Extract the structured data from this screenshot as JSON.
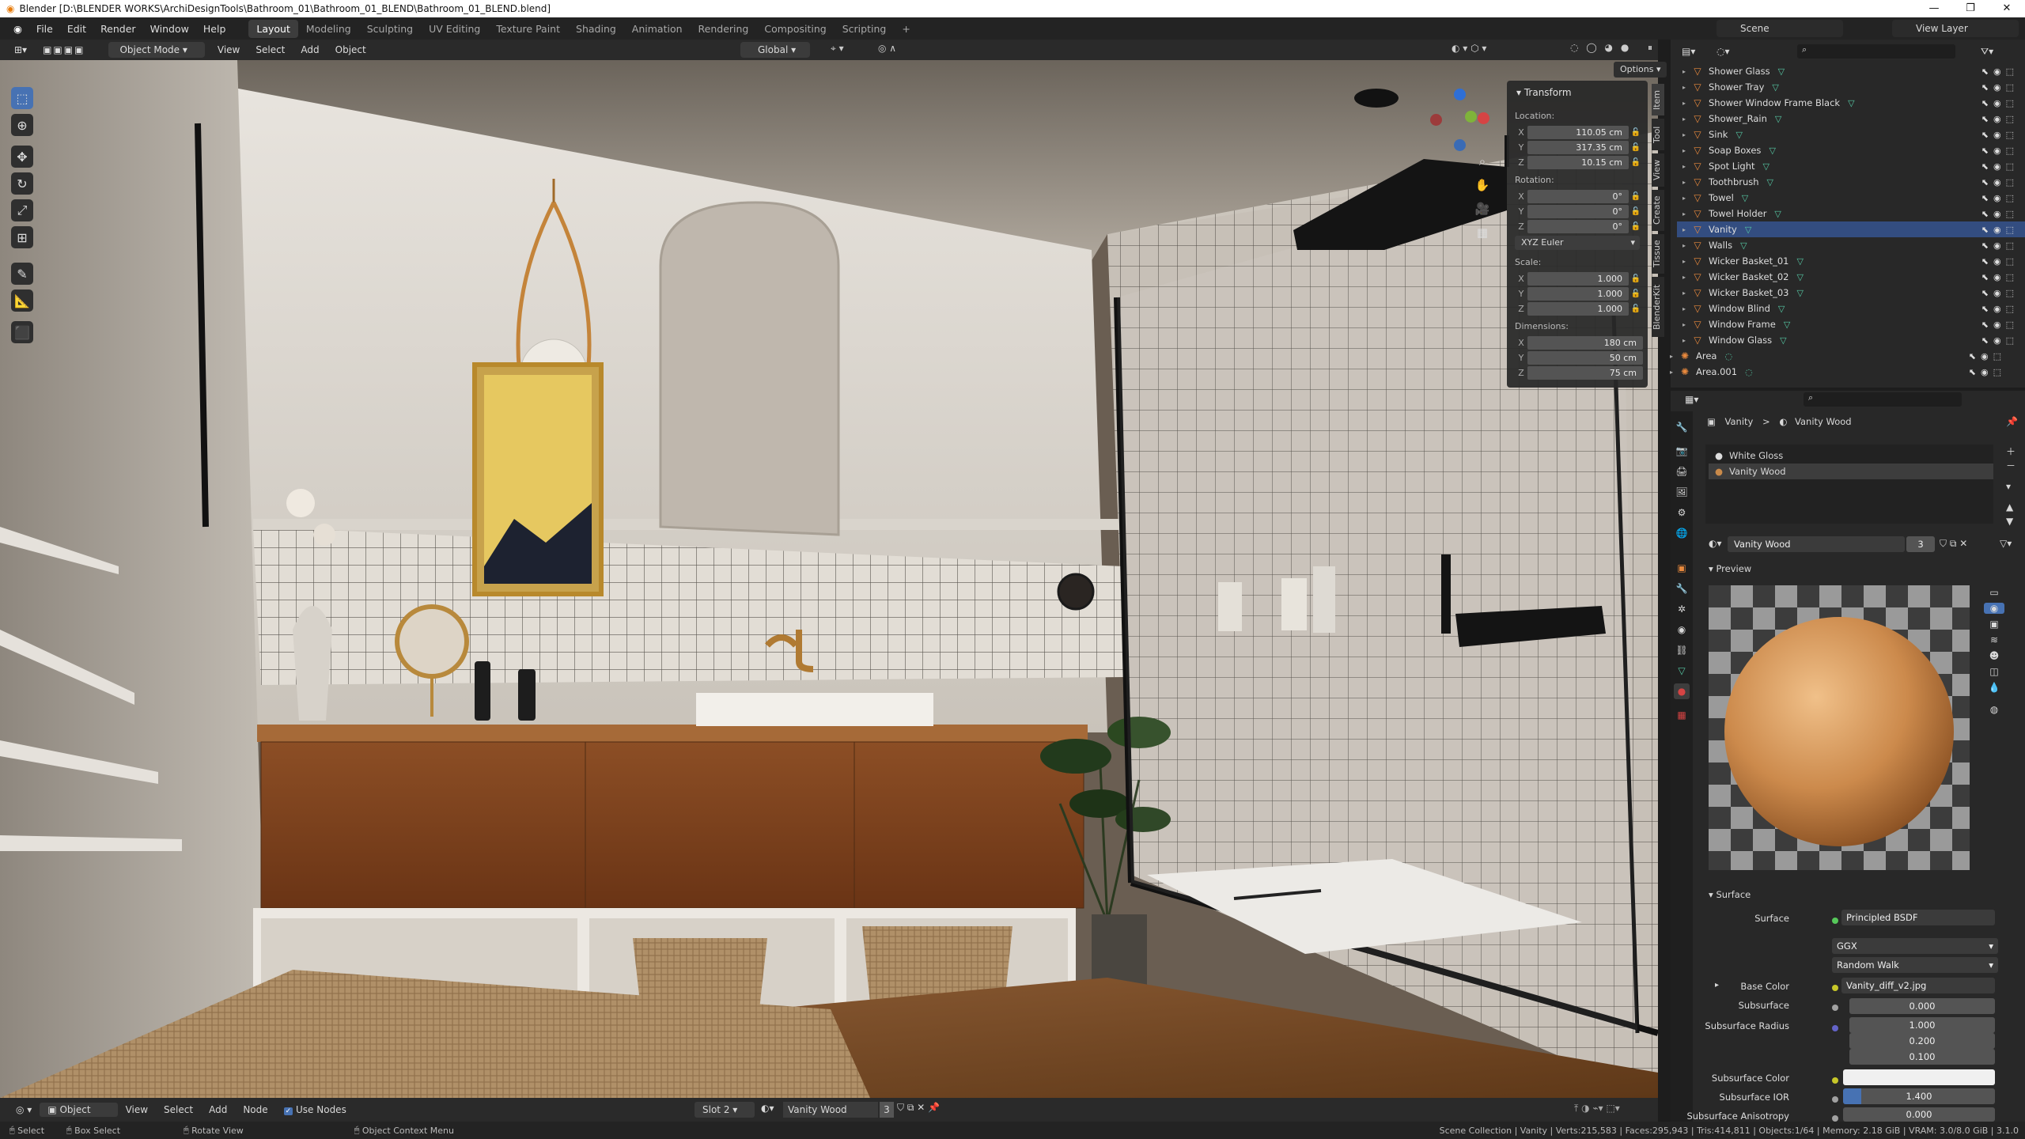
{
  "titlebar": {
    "title": "Blender [D:\\BLENDER WORKS\\ArchiDesignTools\\Bathroom_01\\Bathroom_01_BLEND\\Bathroom_01_BLEND.blend]",
    "min": "—",
    "max": "❐",
    "close": "✕"
  },
  "menu": [
    "File",
    "Edit",
    "Render",
    "Window",
    "Help"
  ],
  "workspaces": [
    "Layout",
    "Modeling",
    "Sculpting",
    "UV Editing",
    "Texture Paint",
    "Shading",
    "Animation",
    "Rendering",
    "Compositing",
    "Scripting"
  ],
  "add_workspace": "+",
  "scene": "Scene",
  "view_layer": "View Layer",
  "viewport_header": {
    "mode": "Object Mode",
    "view": "View",
    "select": "Select",
    "add": "Add",
    "object": "Object",
    "orientation": "Global",
    "options": "Options"
  },
  "transform": {
    "title": "Transform",
    "location_label": "Location:",
    "location": {
      "x": "110.05 cm",
      "y": "317.35 cm",
      "z": "10.15 cm"
    },
    "rotation_label": "Rotation:",
    "rotation": {
      "x": "0°",
      "y": "0°",
      "z": "0°"
    },
    "rotation_mode": "XYZ Euler",
    "scale_label": "Scale:",
    "scale": {
      "x": "1.000",
      "y": "1.000",
      "z": "1.000"
    },
    "dimensions_label": "Dimensions:",
    "dimensions": {
      "x": "180 cm",
      "y": "50 cm",
      "z": "75 cm"
    },
    "axis": {
      "x": "X",
      "y": "Y",
      "z": "Z"
    }
  },
  "npanel_tabs": [
    "Item",
    "Tool",
    "View",
    "Create",
    "Tissue",
    "BlenderKit"
  ],
  "outliner": [
    {
      "name": "Shower Glass",
      "selected": false
    },
    {
      "name": "Shower Tray",
      "selected": false
    },
    {
      "name": "Shower Window Frame Black",
      "selected": false
    },
    {
      "name": "Shower_Rain",
      "selected": false
    },
    {
      "name": "Sink",
      "selected": false
    },
    {
      "name": "Soap Boxes",
      "selected": false
    },
    {
      "name": "Spot Light",
      "selected": false
    },
    {
      "name": "Toothbrush",
      "selected": false
    },
    {
      "name": "Towel",
      "selected": false
    },
    {
      "name": "Towel Holder",
      "selected": false
    },
    {
      "name": "Vanity",
      "selected": true
    },
    {
      "name": "Walls",
      "selected": false
    },
    {
      "name": "Wicker Basket_01",
      "selected": false
    },
    {
      "name": "Wicker Basket_02",
      "selected": false
    },
    {
      "name": "Wicker Basket_03",
      "selected": false
    },
    {
      "name": "Window Blind",
      "selected": false
    },
    {
      "name": "Window Frame",
      "selected": false
    },
    {
      "name": "Window Glass",
      "selected": false
    },
    {
      "name": "Area",
      "selected": false
    },
    {
      "name": "Area.001",
      "selected": false
    }
  ],
  "properties": {
    "breadcrumb_object": "Vanity",
    "breadcrumb_sep": ">",
    "breadcrumb_material": "Vanity Wood",
    "slots": [
      "White Gloss",
      "Vanity Wood"
    ],
    "material_name": "Vanity Wood",
    "users": "3",
    "preview_label": "Preview",
    "surface_section": "Surface",
    "surface_label": "Surface",
    "surface_value": "Principled BSDF",
    "distribution": "GGX",
    "subsurface_method": "Random Walk",
    "base_color_label": "Base Color",
    "base_color_value": "Vanity_diff_v2.jpg",
    "subsurface_label": "Subsurface",
    "subsurface_value": "0.000",
    "radius_label": "Subsurface Radius",
    "radius": [
      "1.000",
      "0.200",
      "0.100"
    ],
    "sub_color_label": "Subsurface Color",
    "ior_label": "Subsurface IOR",
    "ior_value": "1.400",
    "aniso_label": "Subsurface Anisotropy",
    "aniso_value": "0.000"
  },
  "node_header": {
    "editor": "Object",
    "view": "View",
    "select": "Select",
    "add": "Add",
    "node": "Node",
    "use_nodes": "Use Nodes",
    "slot": "Slot 2",
    "material": "Vanity Wood",
    "users": "3"
  },
  "statusbar": {
    "select": "Select",
    "box_select": "Box Select",
    "rotate": "Rotate View",
    "context": "Object Context Menu",
    "stats": "Scene Collection | Vanity | Verts:215,583 | Faces:295,943 | Tris:414,811 | Objects:1/64 | Memory: 2.18 GiB | VRAM: 3.0/8.0 GiB | 3.1.0"
  },
  "colors": {
    "accent": "#4772b3",
    "selection": "#334d80",
    "object_icon": "#e8893d",
    "mesh_icon": "#56c8a4",
    "wood": "#8a4c22"
  }
}
